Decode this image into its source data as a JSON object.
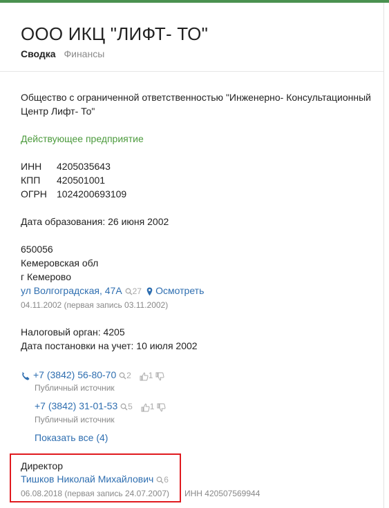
{
  "header": {
    "title": "ООО ИКЦ \"ЛИФТ- ТО\"",
    "tabs": [
      {
        "label": "Сводка"
      },
      {
        "label": "Финансы"
      }
    ]
  },
  "company": {
    "full_name": "Общество с ограниченной ответственностью \"Инженерно- Консультационный Центр Лифт- То\"",
    "status": "Действующее предприятие",
    "inn_label": "ИНН",
    "inn": "4205035643",
    "kpp_label": "КПП",
    "kpp": "420501001",
    "ogrn_label": "ОГРН",
    "ogrn": "1024200693109",
    "founded": "Дата образования: 26 июня 2002"
  },
  "address": {
    "zip": "650056",
    "region": "Кемеровская обл",
    "city": "г Кемерово",
    "street_link": "ул Волгоградская, 47А",
    "search_count": "27",
    "map_link": "Осмотреть",
    "date_note": "04.11.2002 (первая запись 03.11.2002)"
  },
  "tax": {
    "authority": "Налоговый орган: 4205",
    "registered": "Дата постановки на учет: 10 июля 2002"
  },
  "phones": [
    {
      "number": "+7 (3842) 56-80-70",
      "search_count": "2",
      "likes": "1",
      "source": "Публичный источник"
    },
    {
      "number": "+7 (3842) 31-01-53",
      "search_count": "5",
      "likes": "1",
      "source": "Публичный источник"
    }
  ],
  "show_all": "Показать все (4)",
  "director": {
    "title": "Директор",
    "name": "Тишков Николай Михайлович",
    "search_count": "6",
    "date_note": "06.08.2018 (первая запись 24.07.2007)",
    "inn": "ИНН 420507569944"
  },
  "colors": {
    "accent_green": "#4a9150",
    "link": "#2e6eb0",
    "highlight": "#e0191e"
  },
  "icons": [
    "search-icon",
    "map-pin-icon",
    "phone-icon",
    "thumb-up-icon",
    "thumb-down-icon"
  ]
}
